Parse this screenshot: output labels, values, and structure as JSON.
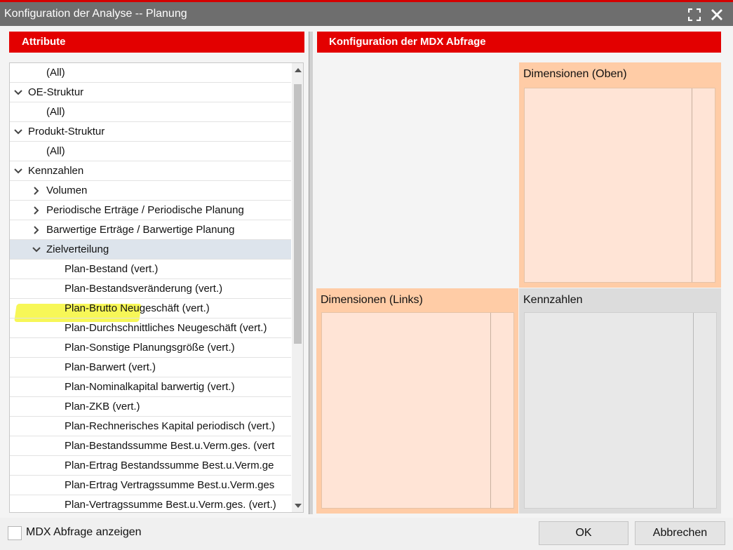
{
  "window": {
    "title": "Konfiguration der Analyse -- Planung",
    "maximize_icon": "maximize-icon",
    "close_icon": "close-icon"
  },
  "left_panel": {
    "header": "Attribute",
    "tree": [
      {
        "label": "(All)",
        "level": 1,
        "expander": "none"
      },
      {
        "label": "OE-Struktur",
        "level": 0,
        "expander": "expanded"
      },
      {
        "label": "(All)",
        "level": 1,
        "expander": "none"
      },
      {
        "label": "Produkt-Struktur",
        "level": 0,
        "expander": "expanded"
      },
      {
        "label": "(All)",
        "level": 1,
        "expander": "none"
      },
      {
        "label": "Kennzahlen",
        "level": 0,
        "expander": "expanded"
      },
      {
        "label": "Volumen",
        "level": 1,
        "expander": "collapsed"
      },
      {
        "label": "Periodische Erträge / Periodische Planung",
        "level": 1,
        "expander": "collapsed"
      },
      {
        "label": "Barwertige Erträge / Barwertige Planung",
        "level": 1,
        "expander": "collapsed"
      },
      {
        "label": "Zielverteilung",
        "level": 1,
        "expander": "expanded",
        "selected": true
      },
      {
        "label": "Plan-Bestand (vert.)",
        "level": 2,
        "expander": "none"
      },
      {
        "label": "Plan-Bestandsveränderung (vert.)",
        "level": 2,
        "expander": "none"
      },
      {
        "label": "Plan-Brutto Neugeschäft (vert.)",
        "level": 2,
        "expander": "none"
      },
      {
        "label": "Plan-Durchschnittliches Neugeschäft (vert.)",
        "level": 2,
        "expander": "none"
      },
      {
        "label": "Plan-Sonstige Planungsgröße (vert.)",
        "level": 2,
        "expander": "none"
      },
      {
        "label": "Plan-Barwert (vert.)",
        "level": 2,
        "expander": "none"
      },
      {
        "label": "Plan-Nominalkapital barwertig (vert.)",
        "level": 2,
        "expander": "none"
      },
      {
        "label": "Plan-ZKB (vert.)",
        "level": 2,
        "expander": "none"
      },
      {
        "label": "Plan-Rechnerisches Kapital periodisch (vert.)",
        "level": 2,
        "expander": "none"
      },
      {
        "label": "Plan-Bestandssumme Best.u.Verm.ges. (vert",
        "level": 2,
        "expander": "none"
      },
      {
        "label": "Plan-Ertrag Bestandssumme Best.u.Verm.ge",
        "level": 2,
        "expander": "none"
      },
      {
        "label": "Plan-Ertrag Vertragssumme Best.u.Verm.ges",
        "level": 2,
        "expander": "none"
      },
      {
        "label": "Plan-Vertragssumme Best.u.Verm.ges. (vert.)",
        "level": 2,
        "expander": "none"
      }
    ]
  },
  "right_panel": {
    "header": "Konfiguration der MDX Abfrage",
    "zones": {
      "oben": "Dimensionen (Oben)",
      "links": "Dimensionen (Links)",
      "kennzahlen": "Kennzahlen"
    }
  },
  "footer": {
    "checkbox_label": "MDX Abfrage anzeigen",
    "checkbox_checked": false,
    "ok_label": "OK",
    "cancel_label": "Abbrechen"
  },
  "colors": {
    "accent_red": "#e30000",
    "titlebar_gray": "#6e6e6e",
    "zone_orange": "#ffcca6",
    "zone_gray": "#dcdcdc",
    "highlight_yellow": "#f6f63a"
  }
}
